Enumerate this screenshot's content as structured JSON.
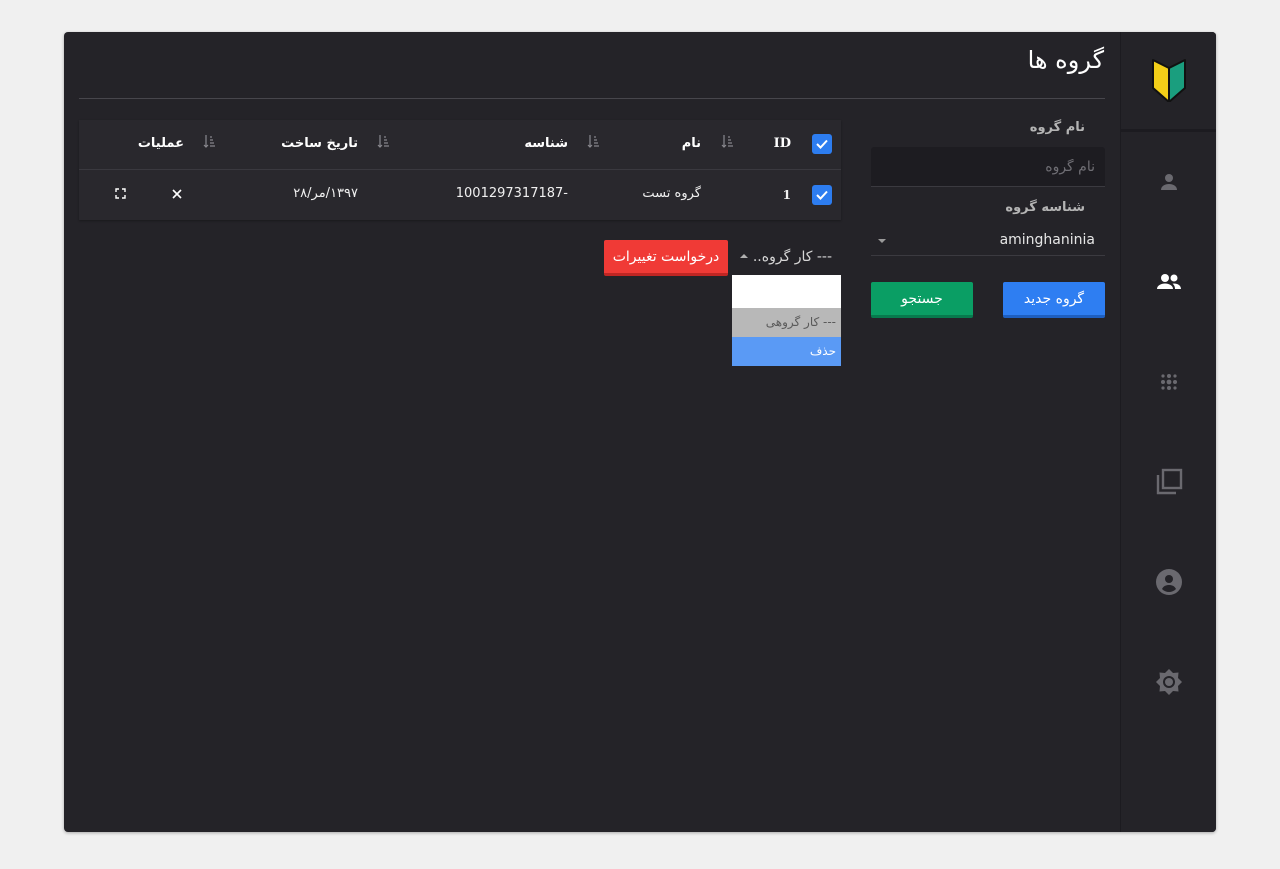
{
  "page": {
    "title": "گروه ها"
  },
  "sidebar": {
    "items": [
      {
        "icon": "person-icon",
        "active": false
      },
      {
        "icon": "group-icon",
        "active": true
      },
      {
        "icon": "dots-grid-icon",
        "active": false
      },
      {
        "icon": "library-icon",
        "active": false
      },
      {
        "icon": "account-circle-icon",
        "active": false
      },
      {
        "icon": "settings-icon",
        "active": false
      }
    ]
  },
  "filters": {
    "group_name_label": "نام گروه",
    "group_name_placeholder": "نام گروه",
    "group_id_label": "شناسه گروه",
    "group_id_value": "aminghaninia",
    "new_group_button": "گروه جدید",
    "search_button": "جستجو"
  },
  "table": {
    "columns": {
      "id": "ID",
      "name": "نام",
      "identifier": "شناسه",
      "created": "تاریخ ساخت",
      "actions": "عملیات"
    },
    "rows": [
      {
        "id": "1",
        "name": "گروه تست",
        "identifier": "-1001297317187",
        "created": "۱۳۹۷/مر/۲۸",
        "selected": true
      }
    ]
  },
  "bulk": {
    "select_value": "--- کار گروه..",
    "apply_button": "درخواست تغییرات",
    "options": [
      {
        "label": "",
        "state": "empty"
      },
      {
        "label": "--- کار گروهی",
        "state": "disabled"
      },
      {
        "label": "حذف",
        "state": "highlighted"
      }
    ]
  },
  "colors": {
    "background": "#242328",
    "primary": "#2e7ef2",
    "success": "#0a9e64",
    "danger": "#f03a36"
  }
}
